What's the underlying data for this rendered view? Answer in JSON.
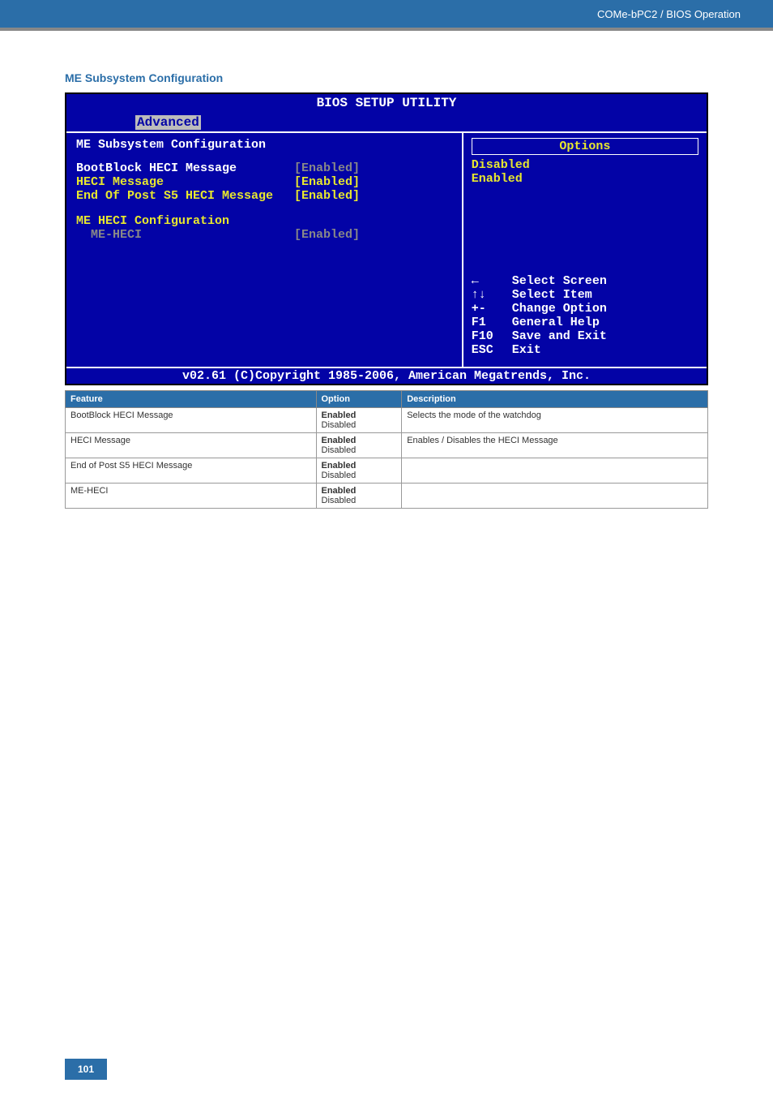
{
  "header": {
    "breadcrumb": "COMe-bPC2 / BIOS Operation"
  },
  "section": {
    "title": "ME Subsystem Configuration"
  },
  "bios": {
    "banner": "BIOS SETUP UTILITY",
    "tab": "Advanced",
    "panel_title": "ME Subsystem Configuration",
    "rows": {
      "r1_label": "BootBlock HECI Message",
      "r1_val": "[Enabled]",
      "r2_label": "HECI Message",
      "r2_val": "[Enabled]",
      "r3_label": "End Of Post S5 HECI Message",
      "r3_val": "[Enabled]",
      "group2_label": "ME HECI Configuration",
      "r4_label": "ME-HECI",
      "r4_val": "[Enabled]"
    },
    "options": {
      "header": "Options",
      "opt1": "Disabled",
      "opt2": "Enabled"
    },
    "nav": {
      "k1": "←",
      "l1": "Select Screen",
      "k2": "↑↓",
      "l2": "Select Item",
      "k3": "+-",
      "l3": "Change Option",
      "k4": "F1",
      "l4": "General Help",
      "k5": "F10",
      "l5": "Save and Exit",
      "k6": "ESC",
      "l6": "Exit"
    },
    "footer": "v02.61 (C)Copyright 1985-2006, American Megatrends, Inc."
  },
  "table": {
    "headers": {
      "c1": "Feature",
      "c2": "Option",
      "c3": "Description"
    },
    "rows": [
      {
        "feature": "BootBlock HECI Message",
        "opt_bold": "Enabled",
        "opt_plain": "Disabled",
        "desc": "Selects the mode of the watchdog"
      },
      {
        "feature": "HECI Message",
        "opt_bold": "Enabled",
        "opt_plain": "Disabled",
        "desc": "Enables / Disables the HECI Message"
      },
      {
        "feature": "End of Post S5 HECI Message",
        "opt_bold": "Enabled",
        "opt_plain": "Disabled",
        "desc": ""
      },
      {
        "feature": "ME-HECI",
        "opt_bold": "Enabled",
        "opt_plain": "Disabled",
        "desc": ""
      }
    ]
  },
  "page": {
    "number": "101"
  }
}
